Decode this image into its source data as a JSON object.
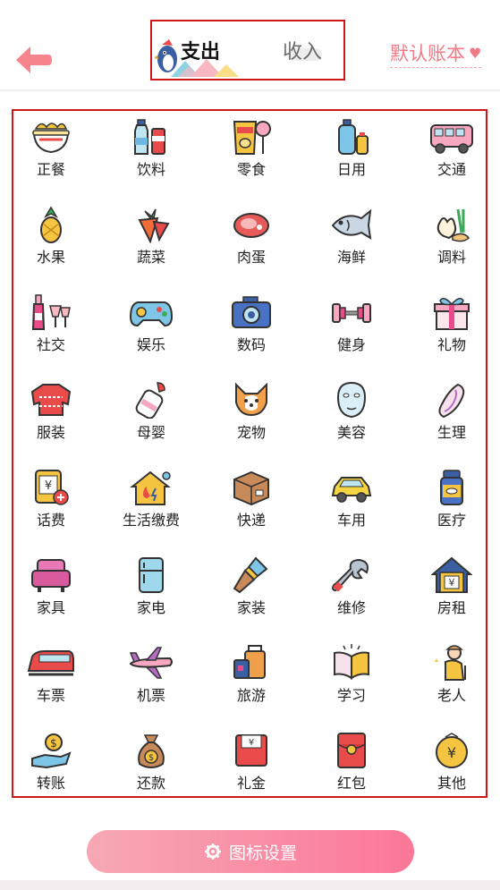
{
  "header": {
    "back_icon": "arrow-left-icon",
    "tabs": [
      {
        "label": "支出",
        "active": true
      },
      {
        "label": "收入",
        "active": false
      }
    ],
    "account_label": "默认账本",
    "account_icon": "heart-icon"
  },
  "categories": [
    {
      "label": "正餐",
      "icon": "noodle-bowl-icon"
    },
    {
      "label": "饮料",
      "icon": "drink-bottles-icon"
    },
    {
      "label": "零食",
      "icon": "chips-candy-icon"
    },
    {
      "label": "日用",
      "icon": "toiletries-icon"
    },
    {
      "label": "交通",
      "icon": "bus-icon"
    },
    {
      "label": "水果",
      "icon": "pineapple-icon"
    },
    {
      "label": "蔬菜",
      "icon": "carrot-icon"
    },
    {
      "label": "肉蛋",
      "icon": "meat-icon"
    },
    {
      "label": "海鲜",
      "icon": "fish-icon"
    },
    {
      "label": "调料",
      "icon": "garlic-ginger-icon"
    },
    {
      "label": "社交",
      "icon": "wine-cheers-icon"
    },
    {
      "label": "娱乐",
      "icon": "gamepad-icon"
    },
    {
      "label": "数码",
      "icon": "camera-icon"
    },
    {
      "label": "健身",
      "icon": "dumbbell-icon"
    },
    {
      "label": "礼物",
      "icon": "gift-box-icon"
    },
    {
      "label": "服装",
      "icon": "sweater-icon"
    },
    {
      "label": "母婴",
      "icon": "baby-bottle-icon"
    },
    {
      "label": "宠物",
      "icon": "dog-face-icon"
    },
    {
      "label": "美容",
      "icon": "face-mask-icon"
    },
    {
      "label": "生理",
      "icon": "sanitary-pad-icon"
    },
    {
      "label": "话费",
      "icon": "phone-bill-icon"
    },
    {
      "label": "生活缴费",
      "icon": "house-utility-icon"
    },
    {
      "label": "快递",
      "icon": "package-box-icon"
    },
    {
      "label": "车用",
      "icon": "car-icon"
    },
    {
      "label": "医疗",
      "icon": "medicine-bottle-icon"
    },
    {
      "label": "家具",
      "icon": "sofa-icon"
    },
    {
      "label": "家电",
      "icon": "refrigerator-icon"
    },
    {
      "label": "家装",
      "icon": "paint-brush-icon"
    },
    {
      "label": "维修",
      "icon": "wrench-icon"
    },
    {
      "label": "房租",
      "icon": "rent-house-icon"
    },
    {
      "label": "车票",
      "icon": "train-icon"
    },
    {
      "label": "机票",
      "icon": "airplane-icon"
    },
    {
      "label": "旅游",
      "icon": "luggage-icon"
    },
    {
      "label": "学习",
      "icon": "open-book-icon"
    },
    {
      "label": "老人",
      "icon": "elderly-person-icon"
    },
    {
      "label": "转账",
      "icon": "coin-hand-icon"
    },
    {
      "label": "还款",
      "icon": "money-bag-icon"
    },
    {
      "label": "礼金",
      "icon": "gift-money-icon"
    },
    {
      "label": "红包",
      "icon": "red-envelope-icon"
    },
    {
      "label": "其他",
      "icon": "yuan-coin-icon"
    }
  ],
  "footer": {
    "settings_label": "图标设置",
    "settings_icon": "gear-icon"
  },
  "colors": {
    "accent_pink": "#f07a86",
    "button_gradient_start": "#f7a8b5",
    "button_gradient_end": "#fb7798",
    "highlight_border": "#d01717"
  }
}
